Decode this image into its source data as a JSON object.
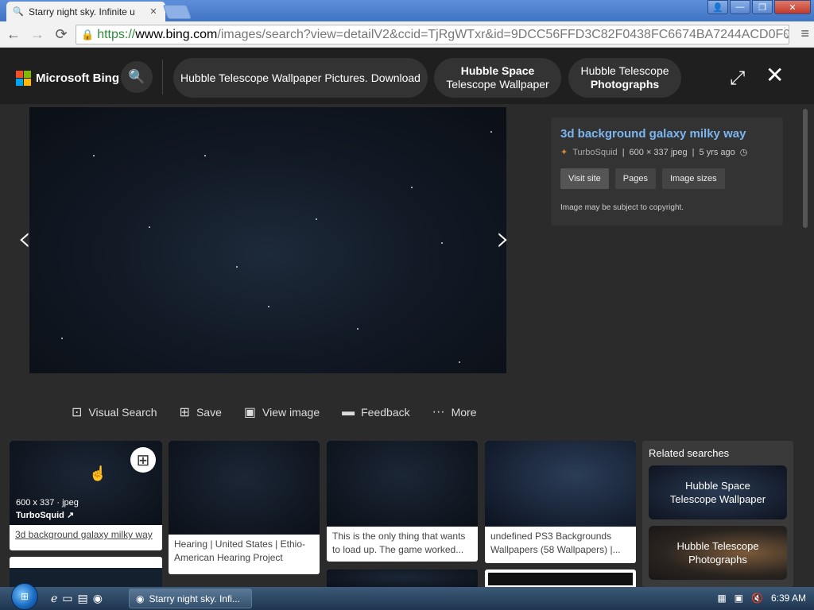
{
  "browser": {
    "tab_title": "Starry night sky. Infinite u",
    "tab_icon": "search-icon",
    "url": {
      "scheme": "https://",
      "host": "www.bing.com",
      "path": "/images/search?view=detailV2&ccid=TjRgWTxr&id=9DCC56FFD3C82F0438FC6674BA7244ACD0F0"
    }
  },
  "header": {
    "logo_text": "Microsoft Bing",
    "pills": [
      {
        "line1": "Hubble Telescope Wallpaper Pictures. Download",
        "line2": ""
      },
      {
        "line1": "Hubble Space",
        "line2": "Telescope Wallpaper"
      },
      {
        "line1": "Hubble Telescope",
        "line2": "Photographs"
      }
    ]
  },
  "detail": {
    "title": "3d background galaxy milky way",
    "source": "TurboSquid",
    "dims": "600 × 337 jpeg",
    "age": "5 yrs ago",
    "buttons": [
      "Visit site",
      "Pages",
      "Image sizes"
    ],
    "copyright": "Image may be subject to copyright."
  },
  "actions": [
    {
      "label": "Visual Search",
      "icon": "visual-search-icon"
    },
    {
      "label": "Save",
      "icon": "save-icon"
    },
    {
      "label": "View image",
      "icon": "view-image-icon"
    },
    {
      "label": "Feedback",
      "icon": "feedback-icon"
    },
    {
      "label": "More",
      "icon": "more-icon"
    }
  ],
  "thumbnails": [
    {
      "meta": "600 x 337 · jpeg",
      "source": "TurboSquid",
      "caption": "3d background galaxy milky way"
    },
    {
      "caption": "Hearing | United States | Ethio-American Hearing Project"
    },
    {
      "caption": "This is the only thing that wants to load up. The game worked..."
    },
    {
      "caption": "undefined PS3 Backgrounds Wallpapers (58 Wallpapers) |..."
    }
  ],
  "related": {
    "title": "Related searches",
    "items": [
      {
        "line1": "Hubble Space",
        "line2": "Telescope Wallpaper"
      },
      {
        "line1": "Hubble Telescope",
        "line2": "Photographs"
      }
    ]
  },
  "taskbar": {
    "active_window": "Starry night sky. Infi...",
    "clock": "6:39 AM"
  }
}
